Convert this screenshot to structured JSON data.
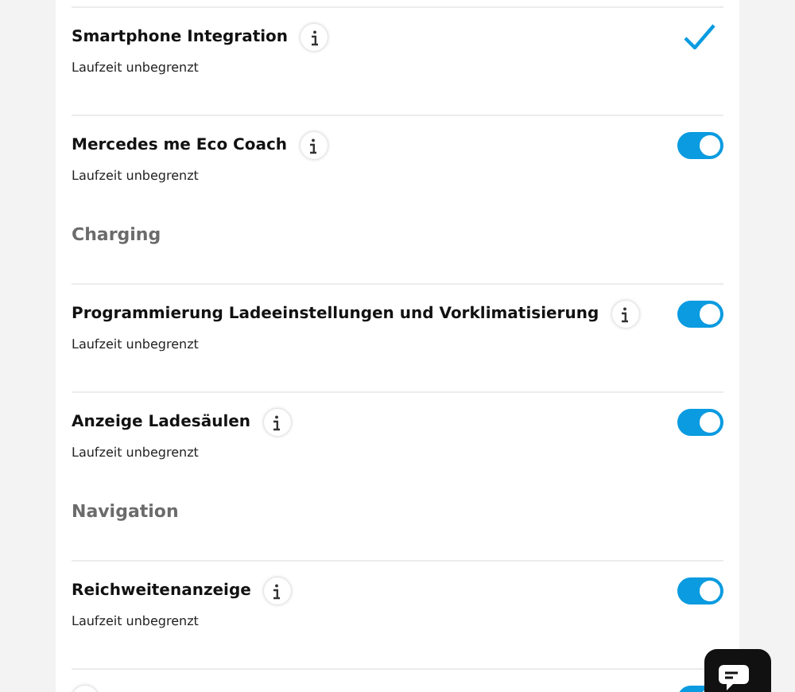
{
  "sections": [
    {
      "items": [
        {
          "kind": "check",
          "title": "Smartphone Integration",
          "subtitle": "Laufzeit unbegrenzt",
          "on": true
        },
        {
          "kind": "toggle",
          "title": "Mercedes me Eco Coach",
          "subtitle": "Laufzeit unbegrenzt",
          "on": true
        }
      ]
    },
    {
      "heading": "Charging",
      "items": [
        {
          "kind": "toggle",
          "title": "Programmierung Ladeeinstellungen und Vorklimatisierung",
          "subtitle": "Laufzeit unbegrenzt",
          "on": true
        },
        {
          "kind": "toggle",
          "title": "Anzeige Ladesäulen",
          "subtitle": "Laufzeit unbegrenzt",
          "on": true
        }
      ]
    },
    {
      "heading": "Navigation",
      "items": [
        {
          "kind": "toggle",
          "title": "Reichweitenanzeige",
          "subtitle": "Laufzeit unbegrenzt",
          "on": true
        },
        {
          "kind": "toggle",
          "on": true
        }
      ]
    }
  ]
}
